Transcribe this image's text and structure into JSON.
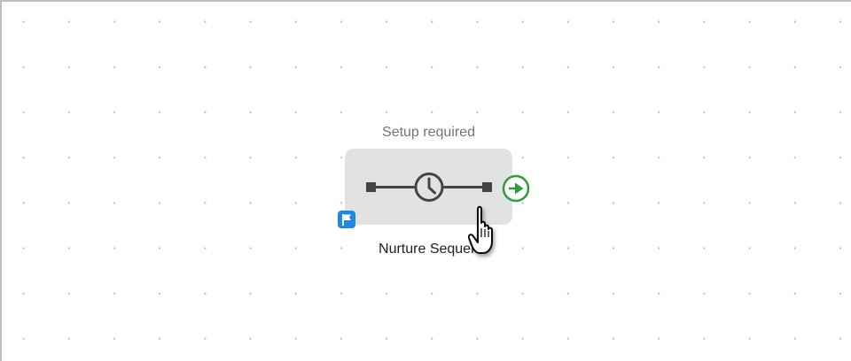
{
  "node": {
    "status": "Setup required",
    "name": "Nurture Sequen",
    "type_icon": "delay-clock-icon",
    "badge_icon": "flag-icon",
    "output_icon": "play-circle-icon"
  },
  "colors": {
    "node_bg": "#e2e2e2",
    "accent_green": "#2e9c3a",
    "badge_blue": "#1e88e5",
    "status_text": "#757575"
  }
}
